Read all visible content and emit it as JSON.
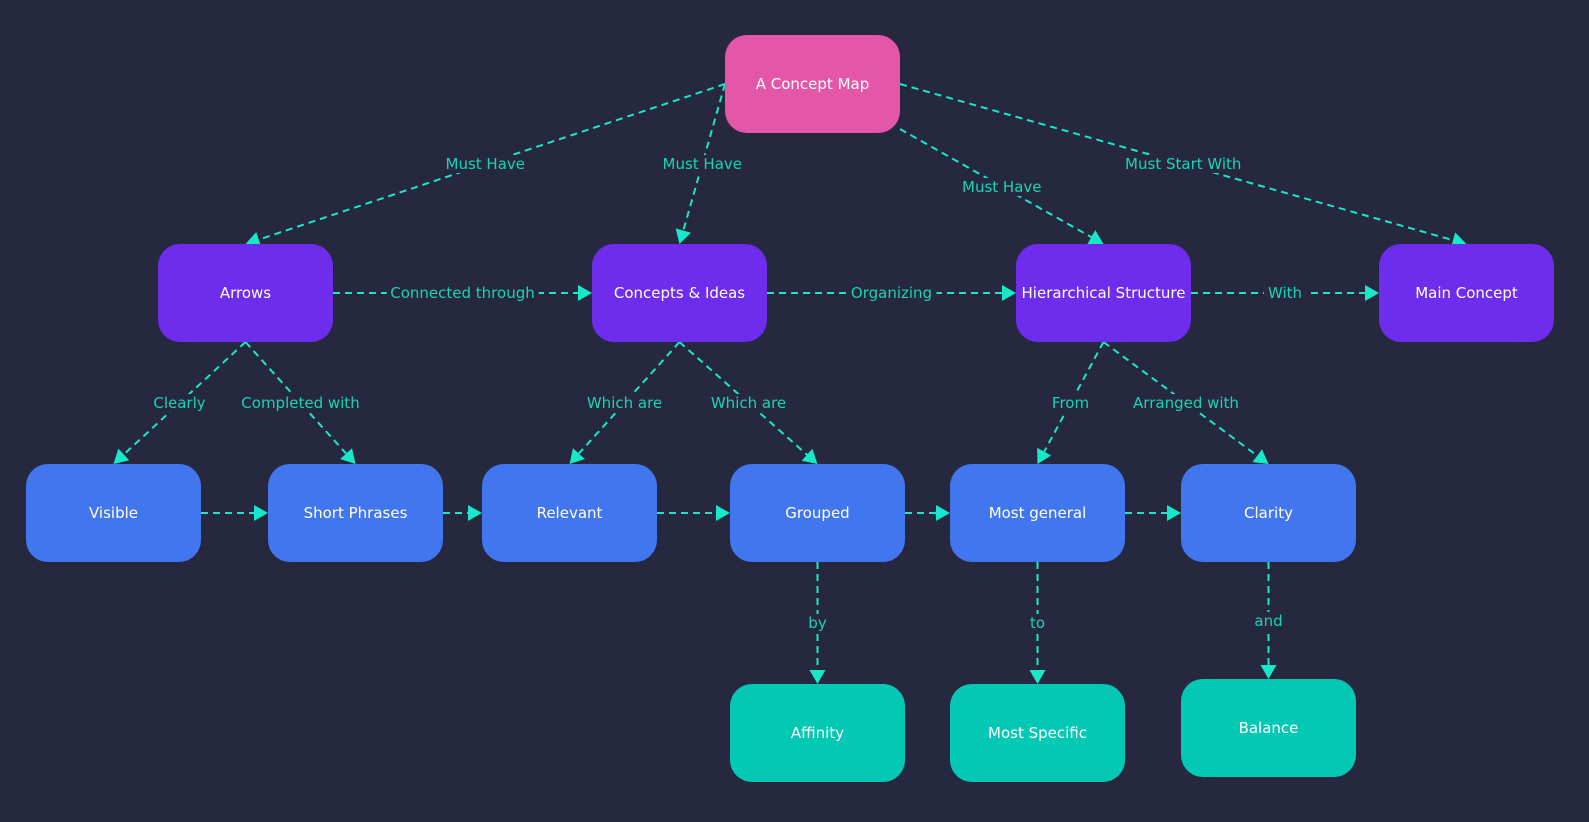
{
  "diagram": {
    "title": "A Concept Map",
    "colors": {
      "background": "#262840",
      "root": "#e457a8",
      "level1": "#6e2ced",
      "level2": "#4276ee",
      "level3": "#03c8b3",
      "edge": "#17e8c8",
      "edge_label": "#17d4b6"
    },
    "nodes": [
      {
        "id": "root",
        "label": "A Concept Map",
        "level": "root"
      },
      {
        "id": "arrows",
        "label": "Arrows",
        "level": "level1"
      },
      {
        "id": "concepts",
        "label": "Concepts & Ideas",
        "level": "level1"
      },
      {
        "id": "hier",
        "label": "Hierarchical Structure",
        "level": "level1"
      },
      {
        "id": "main",
        "label": "Main Concept",
        "level": "level1"
      },
      {
        "id": "visible",
        "label": "Visible",
        "level": "level2"
      },
      {
        "id": "short",
        "label": "Short Phrases",
        "level": "level2"
      },
      {
        "id": "relevant",
        "label": "Relevant",
        "level": "level2"
      },
      {
        "id": "grouped",
        "label": "Grouped",
        "level": "level2"
      },
      {
        "id": "general",
        "label": "Most general",
        "level": "level2"
      },
      {
        "id": "clarity",
        "label": "Clarity",
        "level": "level2"
      },
      {
        "id": "affinity",
        "label": "Affinity",
        "level": "level3"
      },
      {
        "id": "specific",
        "label": "Most Specific",
        "level": "level3"
      },
      {
        "id": "balance",
        "label": "Balance",
        "level": "level3"
      }
    ],
    "edges": [
      {
        "from": "root",
        "to": "arrows",
        "label": "Must Have"
      },
      {
        "from": "root",
        "to": "concepts",
        "label": "Must Have"
      },
      {
        "from": "root",
        "to": "hier",
        "label": "Must Have"
      },
      {
        "from": "root",
        "to": "main",
        "label": "Must Start With"
      },
      {
        "from": "arrows",
        "to": "concepts",
        "label": "Connected through"
      },
      {
        "from": "concepts",
        "to": "hier",
        "label": "Organizing"
      },
      {
        "from": "hier",
        "to": "main",
        "label": "With"
      },
      {
        "from": "arrows",
        "to": "visible",
        "label": "Clearly"
      },
      {
        "from": "arrows",
        "to": "short",
        "label": "Completed with"
      },
      {
        "from": "concepts",
        "to": "relevant",
        "label": "Which are"
      },
      {
        "from": "concepts",
        "to": "grouped",
        "label": "Which are"
      },
      {
        "from": "hier",
        "to": "general",
        "label": "From"
      },
      {
        "from": "hier",
        "to": "clarity",
        "label": "Arranged with"
      },
      {
        "from": "visible",
        "to": "short",
        "label": ""
      },
      {
        "from": "short",
        "to": "relevant",
        "label": ""
      },
      {
        "from": "relevant",
        "to": "grouped",
        "label": ""
      },
      {
        "from": "grouped",
        "to": "general",
        "label": ""
      },
      {
        "from": "general",
        "to": "clarity",
        "label": ""
      },
      {
        "from": "grouped",
        "to": "affinity",
        "label": "by"
      },
      {
        "from": "general",
        "to": "specific",
        "label": "to"
      },
      {
        "from": "clarity",
        "to": "balance",
        "label": "and"
      }
    ]
  }
}
